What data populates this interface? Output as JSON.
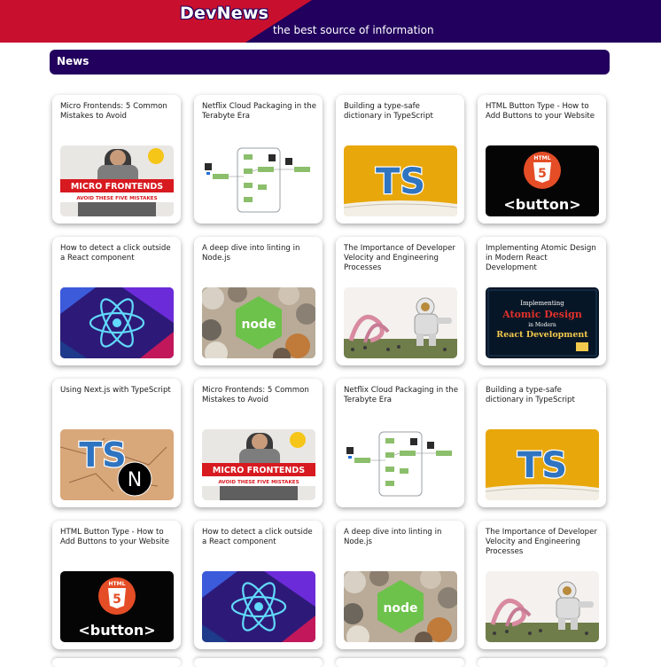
{
  "header": {
    "logo": "DevNews",
    "tagline": "the best source of information",
    "colors": {
      "red": "#c8102e",
      "navy": "#22005e"
    }
  },
  "section": {
    "title": "News"
  },
  "articles": [
    {
      "title": "Micro Frontends: 5 Common Mistakes to Avoid",
      "thumb": "microfrontends",
      "thumb_text": [
        "MICRO FRONTENDS",
        "AVOID THESE FIVE MISTAKES"
      ]
    },
    {
      "title": "Netflix Cloud Packaging in the Terabyte Era",
      "thumb": "netflix"
    },
    {
      "title": "Building a type-safe dictionary in TypeScript",
      "thumb": "ts-book",
      "thumb_text": [
        "TS"
      ]
    },
    {
      "title": "HTML Button Type - How to Add Buttons to your Website",
      "thumb": "html-button",
      "thumb_text": [
        "HTML",
        "5",
        "<button>"
      ]
    },
    {
      "title": "How to detect a click outside a React component",
      "thumb": "react"
    },
    {
      "title": "A deep dive into linting in Node.js",
      "thumb": "node",
      "thumb_text": [
        "node"
      ]
    },
    {
      "title": "The Importance of Developer Velocity and Engineering Processes",
      "thumb": "astronaut"
    },
    {
      "title": "Implementing Atomic Design in Modern React Development",
      "thumb": "atomic",
      "thumb_text": [
        "Implementing",
        "Atomic Design",
        "in Modern",
        "React Development"
      ]
    },
    {
      "title": "Using Next.js with TypeScript",
      "thumb": "ts-next",
      "thumb_text": [
        "TS",
        "N"
      ]
    },
    {
      "title": "Micro Frontends: 5 Common Mistakes to Avoid",
      "thumb": "microfrontends",
      "thumb_text": [
        "MICRO FRONTENDS",
        "AVOID THESE FIVE MISTAKES"
      ]
    },
    {
      "title": "Netflix Cloud Packaging in the Terabyte Era",
      "thumb": "netflix"
    },
    {
      "title": "Building a type-safe dictionary in TypeScript",
      "thumb": "ts-book",
      "thumb_text": [
        "TS"
      ]
    },
    {
      "title": "HTML Button Type - How to Add Buttons to your Website",
      "thumb": "html-button",
      "thumb_text": [
        "HTML",
        "5",
        "<button>"
      ]
    },
    {
      "title": "How to detect a click outside a React component",
      "thumb": "react"
    },
    {
      "title": "A deep dive into linting in Node.js",
      "thumb": "node",
      "thumb_text": [
        "node"
      ]
    },
    {
      "title": "The Importance of Developer Velocity and Engineering Processes",
      "thumb": "astronaut"
    }
  ]
}
